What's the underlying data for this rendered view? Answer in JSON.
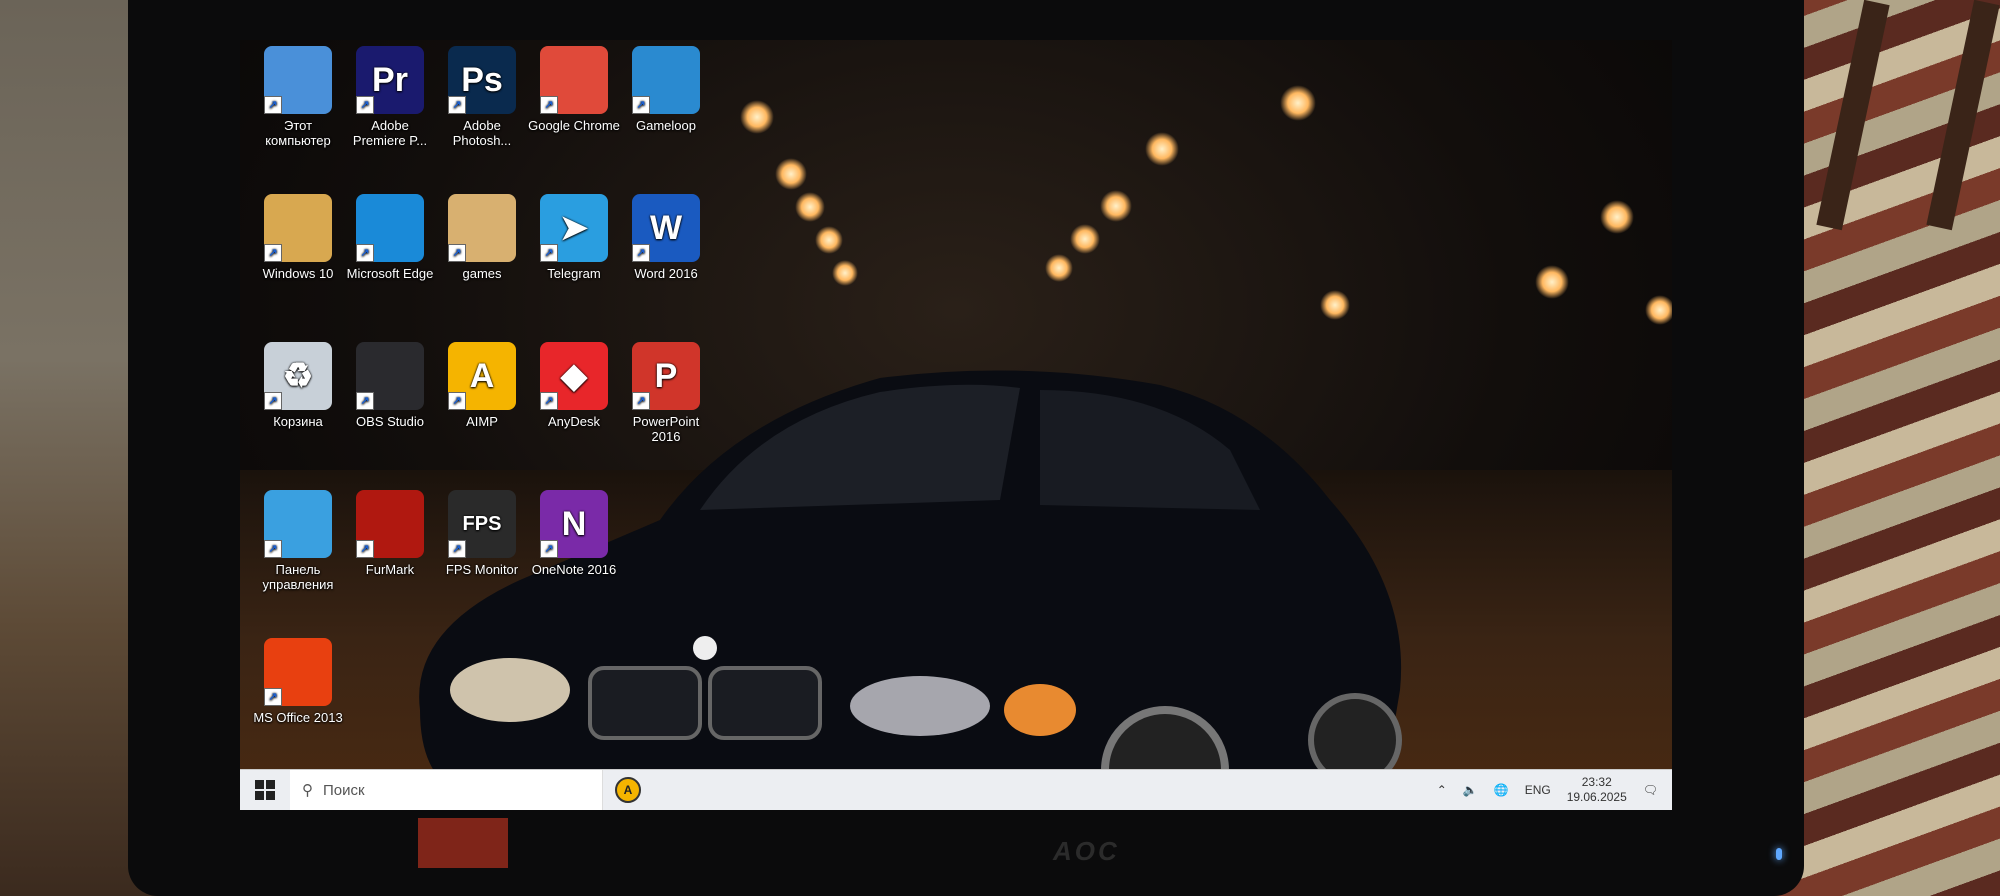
{
  "monitor": {
    "brand": "AOC"
  },
  "desktop_icons": [
    {
      "label": "Этот компьютер",
      "icon": "computer-icon",
      "color": "#4a90d9",
      "glyph": "",
      "col": 0,
      "row": 0
    },
    {
      "label": "Adobe Premiere P...",
      "icon": "premiere-icon",
      "color": "#1a1a6e",
      "glyph": "Pr",
      "col": 1,
      "row": 0
    },
    {
      "label": "Adobe Photosh...",
      "icon": "photoshop-icon",
      "color": "#0a2a4e",
      "glyph": "Ps",
      "col": 2,
      "row": 0
    },
    {
      "label": "Google Chrome",
      "icon": "chrome-icon",
      "color": "#e04a3a",
      "glyph": "",
      "col": 3,
      "row": 0
    },
    {
      "label": "Gameloop",
      "icon": "gameloop-icon",
      "color": "#2a8ad0",
      "glyph": "",
      "col": 4,
      "row": 0
    },
    {
      "label": "Windows 10",
      "icon": "folder-user-icon",
      "color": "#d8a850",
      "glyph": "",
      "col": 0,
      "row": 1
    },
    {
      "label": "Microsoft Edge",
      "icon": "edge-icon",
      "color": "#1a8ad8",
      "glyph": "",
      "col": 1,
      "row": 1
    },
    {
      "label": "games",
      "icon": "folder-icon",
      "color": "#d8b070",
      "glyph": "",
      "col": 2,
      "row": 1
    },
    {
      "label": "Telegram",
      "icon": "telegram-icon",
      "color": "#2a9ee0",
      "glyph": "➤",
      "col": 3,
      "row": 1
    },
    {
      "label": "Word 2016",
      "icon": "word-icon",
      "color": "#1a5ac0",
      "glyph": "W",
      "col": 4,
      "row": 1
    },
    {
      "label": "Корзина",
      "icon": "recycle-bin-icon",
      "color": "#c8d0d8",
      "glyph": "♻",
      "col": 0,
      "row": 2
    },
    {
      "label": "OBS Studio",
      "icon": "obs-icon",
      "color": "#2a2a2e",
      "glyph": "",
      "col": 1,
      "row": 2
    },
    {
      "label": "AIMP",
      "icon": "aimp-icon",
      "color": "#f5b400",
      "glyph": "A",
      "col": 2,
      "row": 2
    },
    {
      "label": "AnyDesk",
      "icon": "anydesk-icon",
      "color": "#e8262a",
      "glyph": "◆",
      "col": 3,
      "row": 2
    },
    {
      "label": "PowerPoint 2016",
      "icon": "powerpoint-icon",
      "color": "#d0352a",
      "glyph": "P",
      "col": 4,
      "row": 2
    },
    {
      "label": "Панель управления",
      "icon": "control-panel-icon",
      "color": "#3aa0e0",
      "glyph": "",
      "col": 0,
      "row": 3
    },
    {
      "label": "FurMark",
      "icon": "furmark-icon",
      "color": "#b01810",
      "glyph": "",
      "col": 1,
      "row": 3
    },
    {
      "label": "FPS Monitor",
      "icon": "fps-monitor-icon",
      "color": "#2a2a2a",
      "glyph": "FPS",
      "col": 2,
      "row": 3
    },
    {
      "label": "OneNote 2016",
      "icon": "onenote-icon",
      "color": "#7a2aa8",
      "glyph": "N",
      "col": 3,
      "row": 3
    },
    {
      "label": "MS Office 2013",
      "icon": "office-icon",
      "color": "#e84010",
      "glyph": "",
      "col": 0,
      "row": 4
    }
  ],
  "taskbar": {
    "search_placeholder": "Поиск",
    "pinned": [
      {
        "icon": "aimp-icon",
        "glyph": "A"
      }
    ],
    "tray": {
      "language": "ENG",
      "time": "23:32",
      "date": "19.06.2025"
    }
  }
}
